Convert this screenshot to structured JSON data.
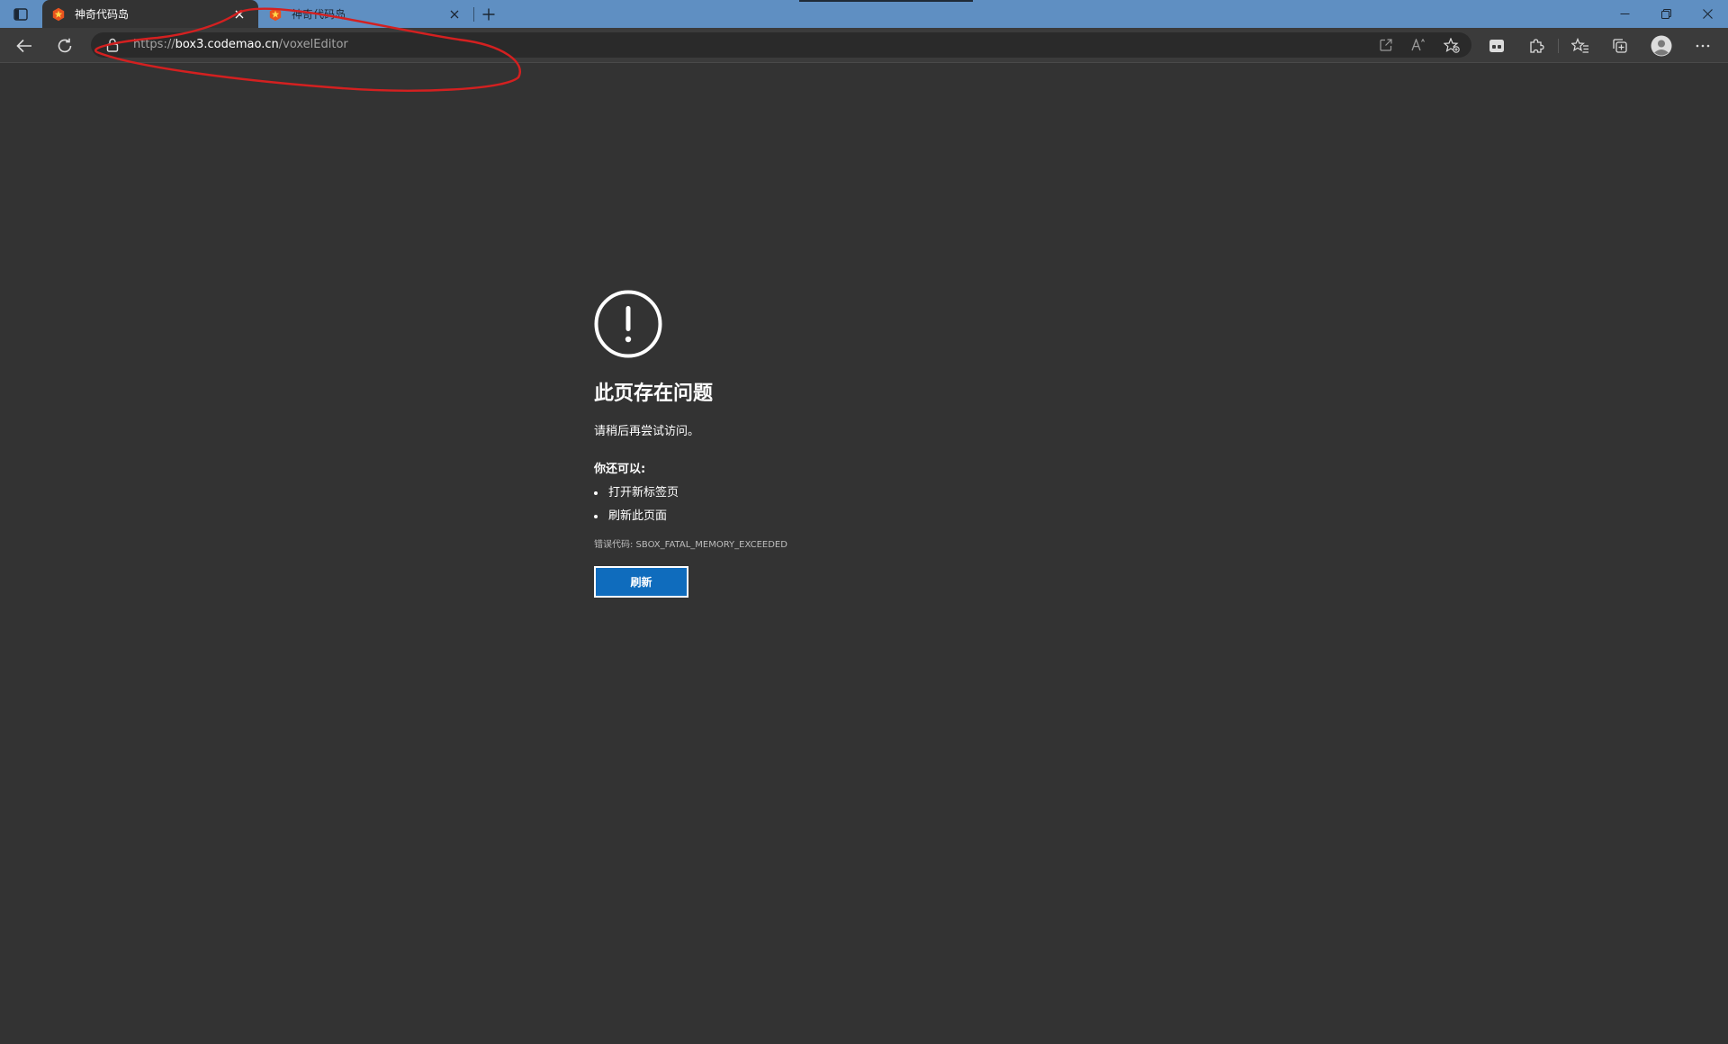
{
  "tabs": [
    {
      "title": "神奇代码岛",
      "active": true,
      "favicon": "codemao-star-icon"
    },
    {
      "title": "神奇代码岛",
      "active": false,
      "favicon": "codemao-star-icon"
    }
  ],
  "address_bar": {
    "url_scheme": "https://",
    "url_host": "box3.codemao.cn",
    "url_path": "/voxelEditor"
  },
  "error_page": {
    "title": "此页存在问题",
    "subtitle": "请稍后再尝试访问。",
    "options_heading": "你还可以:",
    "options": [
      "打开新标签页",
      "刷新此页面"
    ],
    "error_code": "错误代码: SBOX_FATAL_MEMORY_EXCEEDED",
    "reload_button": "刷新"
  },
  "colors": {
    "tabstrip": "#5f8fc2",
    "page_background": "#333333",
    "toolbar": "#3b3b3b",
    "address_bar": "#2a2a2a",
    "reload_button": "#0f6cbd",
    "annotation": "#d42020",
    "favicon": "#e8531e"
  },
  "icons": {
    "tab_actions": "tab-actions-icon",
    "close_tab": "close-icon",
    "new_tab": "plus-icon",
    "back": "back-arrow-icon",
    "refresh": "refresh-icon",
    "site_info": "lock-icon",
    "open_in_app": "open-external-icon",
    "read_aloud": "read-aloud-icon",
    "add_favorite": "star-add-icon",
    "extension_1": "extension-badge-icon",
    "extensions": "puzzle-icon",
    "favorites": "favorites-icon",
    "collections": "collections-icon",
    "profile": "avatar",
    "menu": "ellipsis-icon",
    "minimize": "minimize-icon",
    "restore": "restore-icon",
    "close_window": "close-icon",
    "error": "warning-circle-icon"
  }
}
